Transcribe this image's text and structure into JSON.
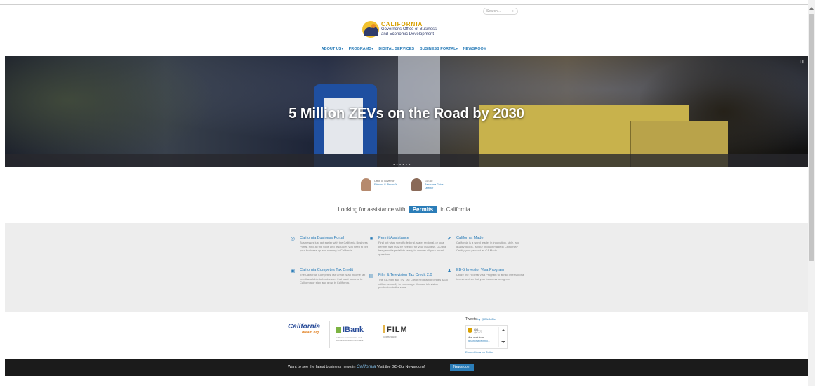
{
  "search": {
    "placeholder": "Search..."
  },
  "logo": {
    "line1": "CALIFORNIA",
    "line2": "Governor's Office of Business",
    "line3": "and Economic Development"
  },
  "nav": {
    "items": [
      "ABOUT US▾",
      "PROGRAMS▾",
      "DIGITAL SERVICES",
      "BUSINESS PORTAL▾",
      "NEWSROOM"
    ]
  },
  "hero": {
    "headline": "5 Million ZEVs on the Road by 2030",
    "dots": "●●●●●●"
  },
  "people": [
    {
      "l1": "Office of Governor",
      "l2": "Edmund G. Brown Jr.",
      "l3": ""
    },
    {
      "l1": "GO-Biz",
      "l2": "Panorama Guide",
      "l3": "Director"
    }
  ],
  "assist": {
    "prefix": "Looking for assistance with",
    "pill": "Permits",
    "suffix": "in California"
  },
  "features": [
    {
      "icon": "◎",
      "title": "California Business Portal",
      "desc": "Businesses just got easier with the California Business Portal. Find all the tools and resources you need to get your business up and running in California."
    },
    {
      "icon": "▣",
      "title": "California Competes Tax Credit",
      "desc": "The California Competes Tax Credit is an income tax credit available to businesses that want to come to California or stay and grow in California."
    },
    {
      "icon": "■",
      "title": "Permit Assistance",
      "desc": "Find out what specific federal, state, regional, or local permits that may be needed for your business. GO-Biz has permit specialists ready to answer all your permit questions."
    },
    {
      "icon": "▤",
      "title": "Film & Television Tax Credit 2.0",
      "desc": "The CA Film and T.V. Tax Credit Program provides $330 million annually to encourage film and television production in the state."
    },
    {
      "icon": "✔",
      "title": "California Made",
      "desc": "California is a world leader in innovation, style, and quality goods. Is your product made in California? Certify your product as CA Made."
    },
    {
      "icon": "♟",
      "title": "EB-5 Investor Visa Program",
      "desc": "Utilize the Federal Visa Program to attract international investment so that your business can grow."
    }
  ],
  "partners": {
    "ca_dream": "California",
    "ca_dream_sub": "dream big",
    "ibank": "IBank",
    "ibank_sub": "California Infrastructure and Economic Development Bank",
    "film": "FILM",
    "film_sub": "COMMISSION"
  },
  "tweets": {
    "title": "Tweets",
    "by": "by @CAGoBiz",
    "name": "GO-...",
    "handle": "@CAG...",
    "msg1": "Nice work from",
    "msg2": "@SonomaTechnol...",
    "footer": "Embed  View on Twitter"
  },
  "newsbar": {
    "prefix": "Want to see the latest business news in",
    "cal": "California",
    "suffix": "Visit the GO-Biz Newsroom!",
    "button": "Newsroom"
  }
}
